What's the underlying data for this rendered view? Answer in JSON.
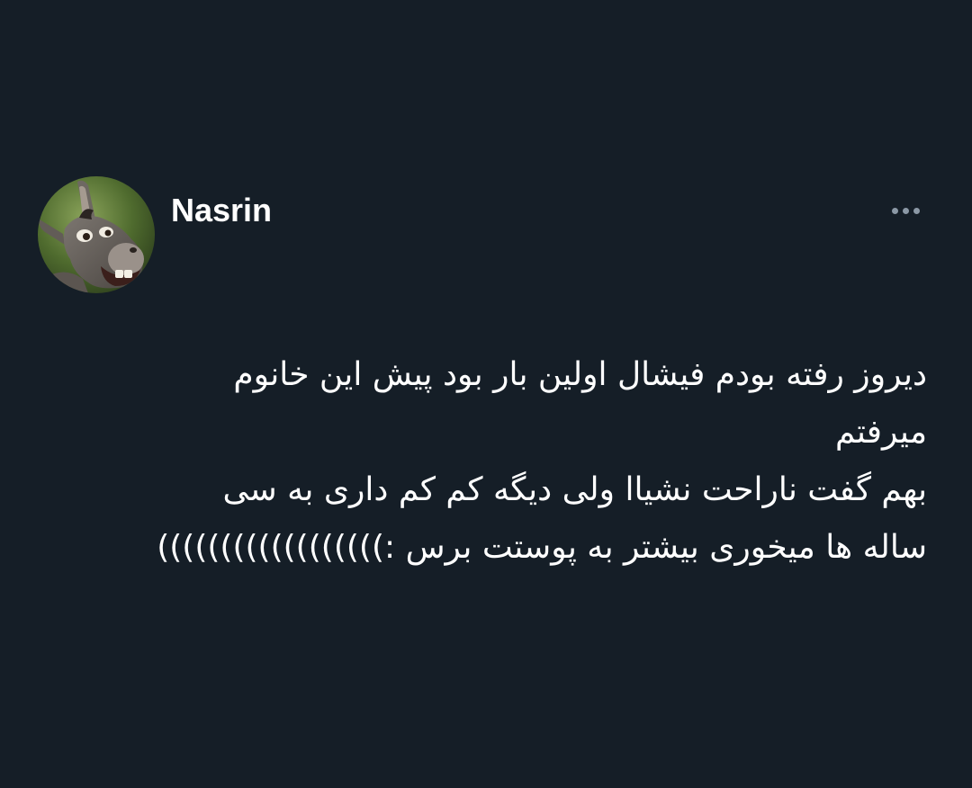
{
  "author": {
    "display_name": "Nasrin",
    "avatar_icon": "donkey-avatar-icon"
  },
  "menu": {
    "icon": "more-dots-icon"
  },
  "tweet": {
    "lines": [
      "دیروز رفته بودم فیشال اولین بار بود پیش این خانوم",
      "میرفتم",
      "بهم گفت ناراحت نشیاا ولی دیگه کم کم داری به سی",
      "ساله ها میخوری بیشتر به پوستت برس :))))))))))))))))))"
    ]
  },
  "colors": {
    "background": "#151e27",
    "text": "#ffffff",
    "secondary": "#8b98a5"
  }
}
